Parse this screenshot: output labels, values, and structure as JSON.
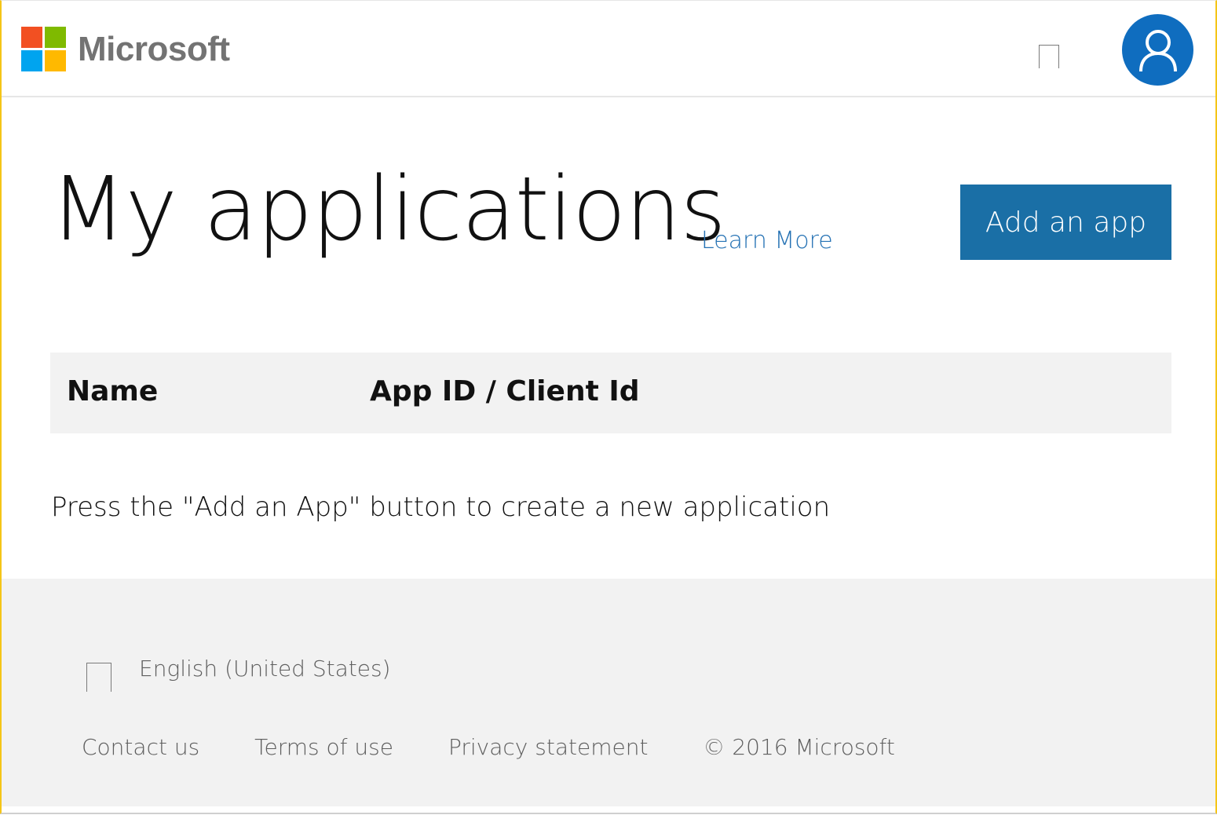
{
  "header": {
    "brand": "Microsoft",
    "logo_colors": [
      "#f25022",
      "#7fba00",
      "#00a4ef",
      "#ffb900"
    ],
    "avatar_icon": "user-icon",
    "avatar_color": "#0f6dbf"
  },
  "main": {
    "title": "My applications",
    "learn_more": "Learn More",
    "add_app_label": "Add an app",
    "table": {
      "columns": [
        "Name",
        "App ID / Client Id"
      ]
    },
    "empty_message": "Press the \"Add an App\" button to create a new application"
  },
  "footer": {
    "language": "English (United States)",
    "links": [
      "Contact us",
      "Terms of use",
      "Privacy statement"
    ],
    "copyright": "© 2016 Microsoft"
  },
  "colors": {
    "accent": "#1a6fa6",
    "link": "#2572b4",
    "footer_bg": "#f2f2f2",
    "table_header_bg": "#f2f2f2"
  }
}
